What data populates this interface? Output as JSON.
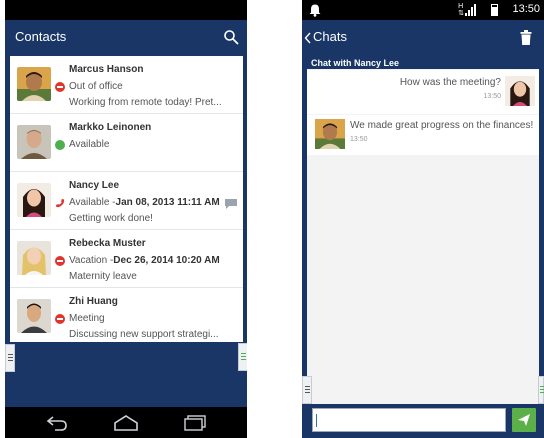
{
  "left_screen": {
    "title": "Contacts",
    "icons": {
      "search": "search-icon"
    },
    "contacts": [
      {
        "name": "Marcus Hanson",
        "status": "Out of office",
        "status_date": "",
        "message": "Working from remote today! Pret...",
        "status_type": "busy"
      },
      {
        "name": "Markko Leinonen",
        "status": "Available",
        "status_date": "",
        "message": "",
        "status_type": "available"
      },
      {
        "name": "Nancy Lee",
        "status": "Available - ",
        "status_date": "Jan 08, 2013 11:11 AM",
        "message": "Getting work done!",
        "status_type": "phone"
      },
      {
        "name": "Rebecka Muster",
        "status": "Vacation - ",
        "status_date": "Dec 26, 2014 10:20 AM",
        "message": "Maternity leave",
        "status_type": "busy"
      },
      {
        "name": "Zhi Huang",
        "status": "Meeting",
        "status_date": "",
        "message": "Discussing new support strategi...",
        "status_type": "busy"
      }
    ]
  },
  "right_screen": {
    "status_time": "13:50",
    "title": "Chats",
    "chat_header": "Chat with Nancy Lee",
    "messages": [
      {
        "text": "How was the meeting?",
        "time": "13:50",
        "side": "right"
      },
      {
        "text": "We made great progress on the finances!",
        "time": "13:50",
        "side": "left"
      }
    ],
    "input_value": ""
  },
  "colors": {
    "brand": "#1a3666",
    "busy": "#e0342f",
    "available": "#4caf50",
    "phone": "#e0342f",
    "send": "#5bb04a"
  }
}
